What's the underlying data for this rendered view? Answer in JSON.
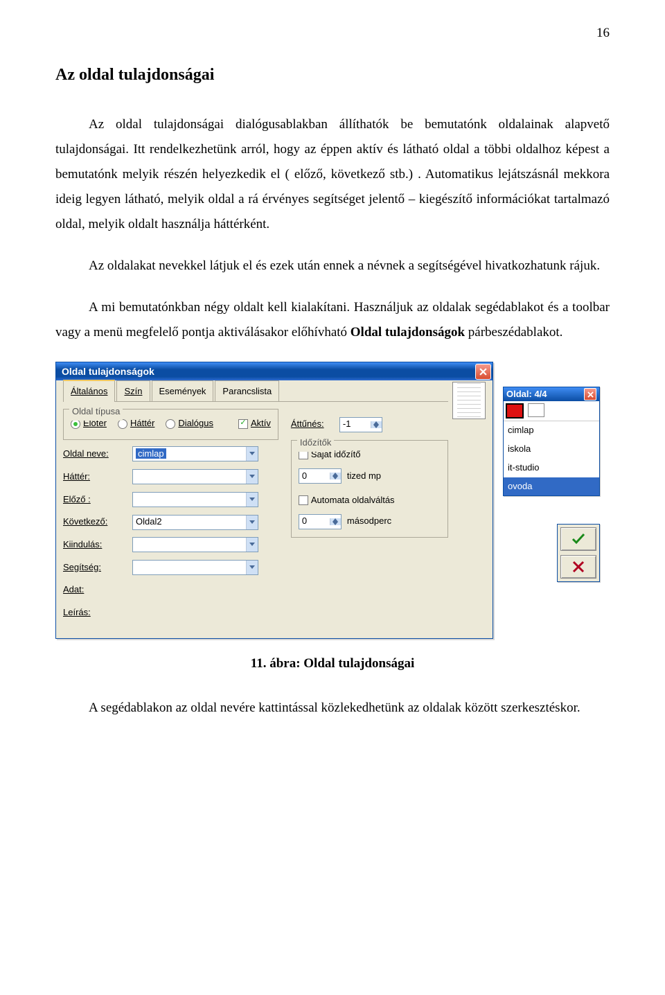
{
  "page_number": "16",
  "heading": "Az oldal tulajdonságai",
  "paragraphs": {
    "p1": "Az oldal tulajdonságai dialógusablakban állíthatók be bemutatónk oldalainak alapvető tulajdonságai. Itt rendelkezhetünk arról, hogy az éppen aktív és látható oldal a többi oldalhoz képest a bemutatónk melyik részén helyezkedik el ( előző, következő stb.) . Automatikus lejátszásnál mekkora ideig legyen látható, melyik oldal a rá érvényes segítséget jelentő – kiegészítő információkat tartalmazó oldal, melyik oldalt használja háttérként.",
    "p2": "Az oldalakat nevekkel látjuk el és ezek után ennek a névnek a segítségével hivatkozhatunk rájuk.",
    "p3_a": "A mi bemutatónkban négy oldalt kell kialakítani. Használjuk az oldalak segédablakot és a toolbar vagy a menü megfelelő pontja aktiválásakor előhívható ",
    "p3_bold": "Oldal tulajdonságok",
    "p3_b": " párbeszédablakot."
  },
  "dialog": {
    "title": "Oldal tulajdonságok",
    "tabs": {
      "general": "Általános",
      "color": "Szín",
      "events": "Események",
      "cmdlist": "Parancslista"
    },
    "group_type": "Oldal típusa",
    "radios": {
      "fore": "Előtér",
      "back": "Háttér",
      "dlg": "Dialógus"
    },
    "active_chk": "Aktív",
    "fields": {
      "name_label": "Oldal neve:",
      "name_value": "cimlap",
      "bg_label": "Háttér:",
      "prev_label": "Előző :",
      "next_label": "Következő:",
      "next_value": "Oldal2",
      "start_label": "Kiindulás:",
      "help_label": "Segítség:",
      "data_label": "Adat:",
      "desc_label": "Leírás:"
    },
    "fade_label": "Áttűnés:",
    "fade_value": "-1",
    "timer_group": "Időzítők",
    "own_timer": "Saját időzítő",
    "tenth": "tized mp",
    "tenth_value": "0",
    "auto": "Automata oldalváltás",
    "sec": "másodperc",
    "sec_value": "0"
  },
  "palette": {
    "title": "Oldal: 4/4",
    "items": [
      "cimlap",
      "iskola",
      "it-studio",
      "ovoda"
    ],
    "selected": "ovoda"
  },
  "fig_caption": "11. ábra: Oldal tulajdonságai",
  "footer": "A segédablakon az oldal nevére kattintással közlekedhetünk az oldalak között szerkesztéskor."
}
